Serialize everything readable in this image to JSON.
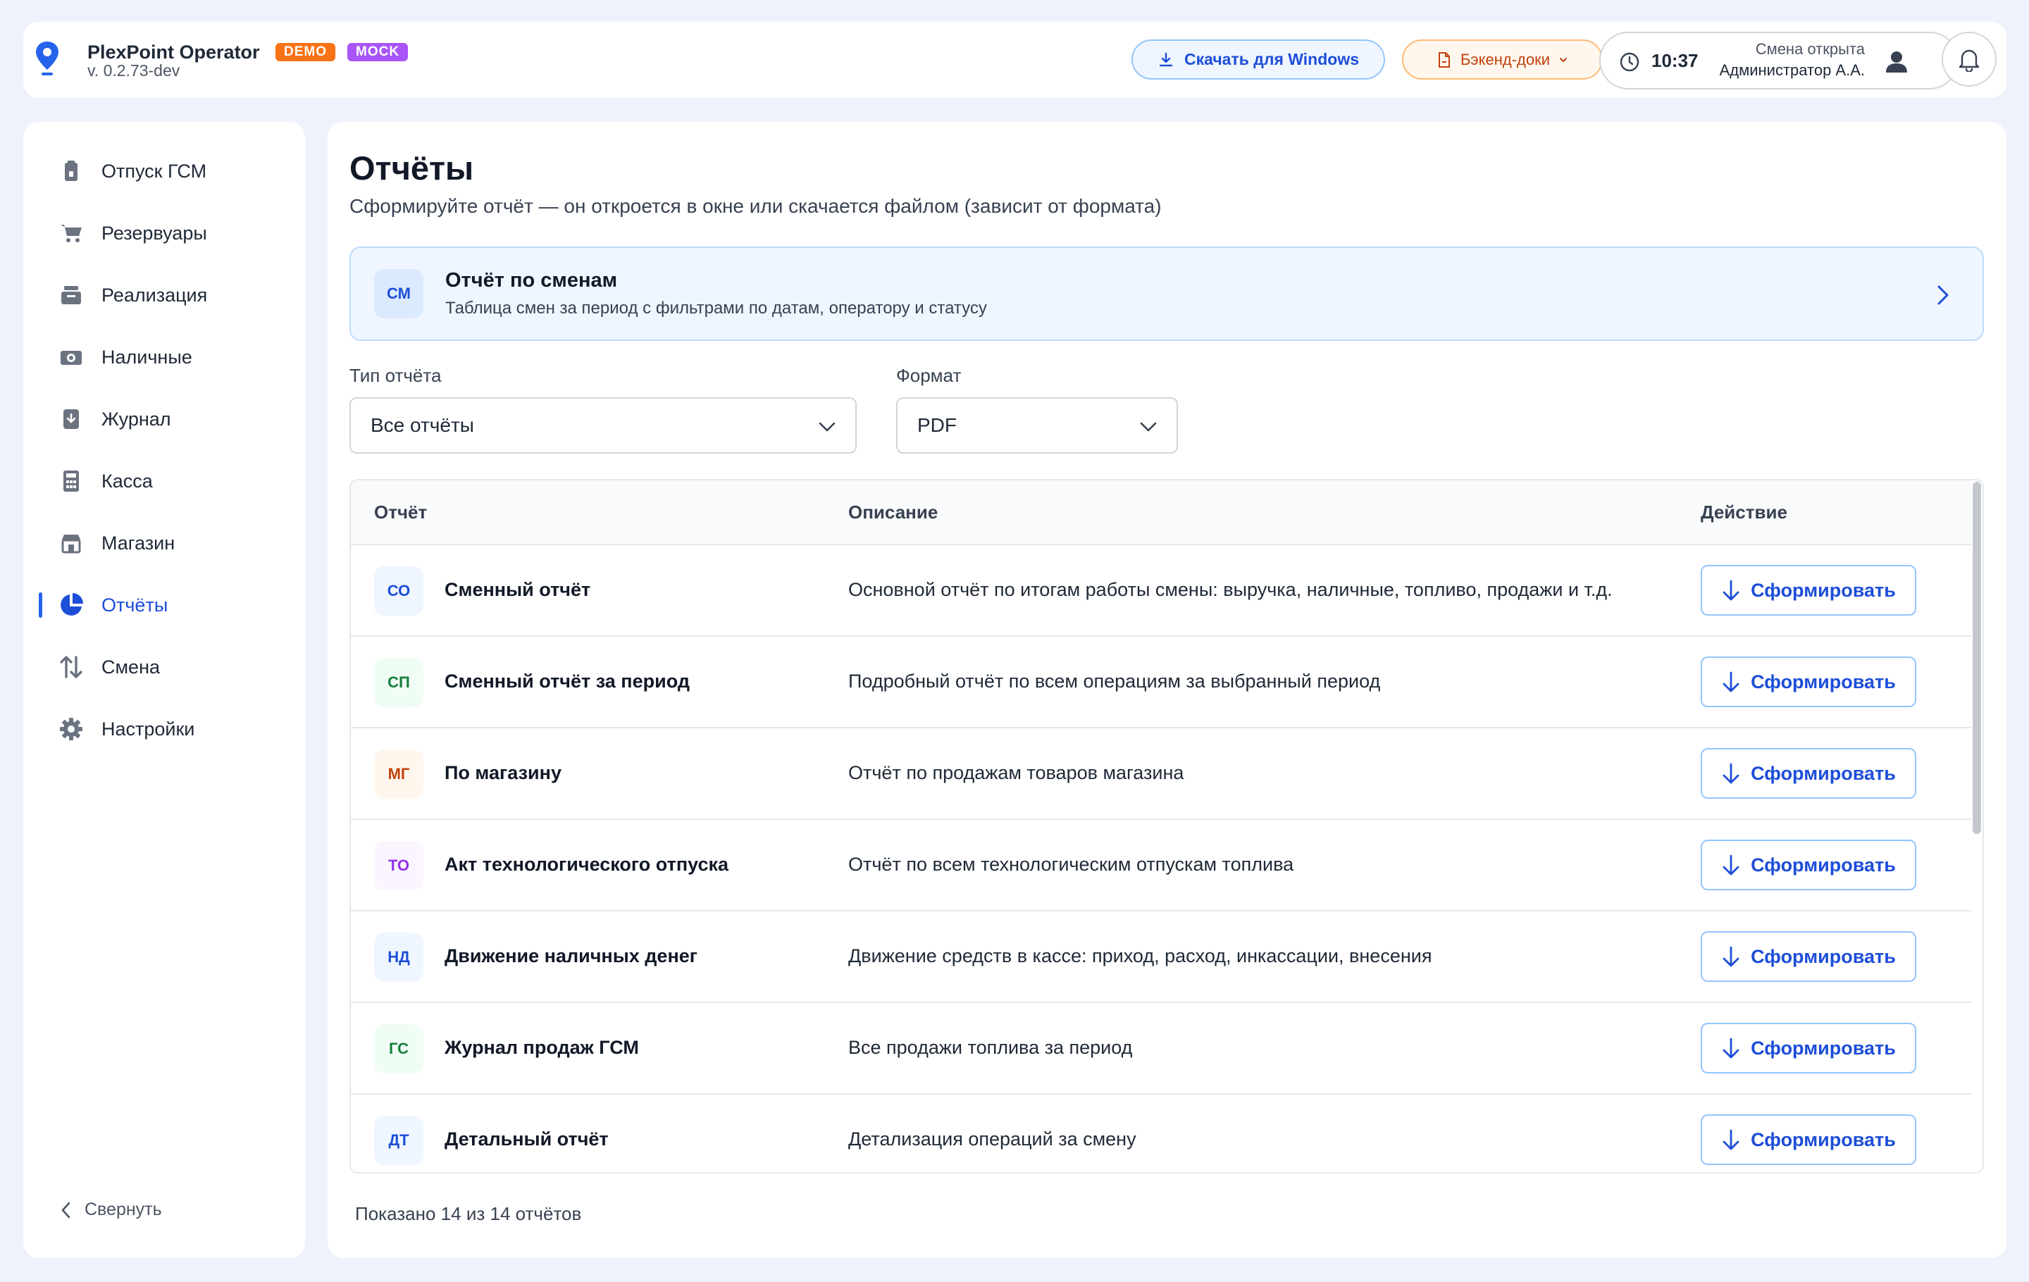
{
  "app": {
    "name": "PlexPoint Operator",
    "badges": [
      "DEMO",
      "MOCK"
    ],
    "version": "v. 0.2.73-dev"
  },
  "header": {
    "download_label": "Скачать для Windows",
    "docs_label": "Бэкенд-доки",
    "time": "10:37",
    "shift_status": "Смена открыта",
    "user": "Администратор А.А."
  },
  "sidebar": {
    "items": [
      {
        "label": "Отпуск ГСМ",
        "icon": "fuel-can-icon",
        "active": false
      },
      {
        "label": "Резервуары",
        "icon": "cart-icon",
        "active": false
      },
      {
        "label": "Реализация",
        "icon": "inbox-icon",
        "active": false
      },
      {
        "label": "Наличные",
        "icon": "cash-icon",
        "active": false
      },
      {
        "label": "Журнал",
        "icon": "journal-icon",
        "active": false
      },
      {
        "label": "Касса",
        "icon": "calculator-icon",
        "active": false
      },
      {
        "label": "Магазин",
        "icon": "store-icon",
        "active": false
      },
      {
        "label": "Отчёты",
        "icon": "pie-chart-icon",
        "active": true
      },
      {
        "label": "Смена",
        "icon": "swap-icon",
        "active": false
      },
      {
        "label": "Настройки",
        "icon": "gear-icon",
        "active": false
      }
    ],
    "collapse_label": "Свернуть"
  },
  "main": {
    "title": "Отчёты",
    "subtitle": "Сформируйте отчёт — он откроется в окне или скачается файлом (зависит от формата)",
    "feature": {
      "chip": "СМ",
      "title": "Отчёт по сменам",
      "description": "Таблица смен за период с фильтрами по датам, оператору и статусу"
    },
    "filters": {
      "type_label": "Тип отчёта",
      "type_value": "Все отчёты",
      "format_label": "Формат",
      "format_value": "PDF"
    },
    "table": {
      "headers": [
        "Отчёт",
        "Описание",
        "Действие"
      ],
      "action_label": "Сформировать",
      "rows": [
        {
          "chip": "СО",
          "name": "Сменный отчёт",
          "description": "Основной отчёт по итогам работы смены: выручка, наличные, топливо, продажи и т.д."
        },
        {
          "chip": "СП",
          "name": "Сменный отчёт за период",
          "description": "Подробный отчёт по всем операциям за выбранный период"
        },
        {
          "chip": "МГ",
          "name": "По магазину",
          "description": "Отчёт по продажам товаров магазина"
        },
        {
          "chip": "ТО",
          "name": "Акт технологического отпуска",
          "description": "Отчёт по всем технологическим отпускам топлива"
        },
        {
          "chip": "НД",
          "name": "Движение наличных денег",
          "description": "Движение средств в кассе: приход, расход, инкассации, внесения"
        },
        {
          "chip": "ГС",
          "name": "Журнал продаж ГСМ",
          "description": "Все продажи топлива за период"
        },
        {
          "chip": "ДТ",
          "name": "Детальный отчёт",
          "description": "Детализация операций за смену"
        }
      ]
    },
    "footer": "Показано 14 из 14 отчётов"
  },
  "colors": {
    "accent": "#2563eb",
    "demo_badge": "#f97316",
    "mock_badge": "#a855f7"
  }
}
